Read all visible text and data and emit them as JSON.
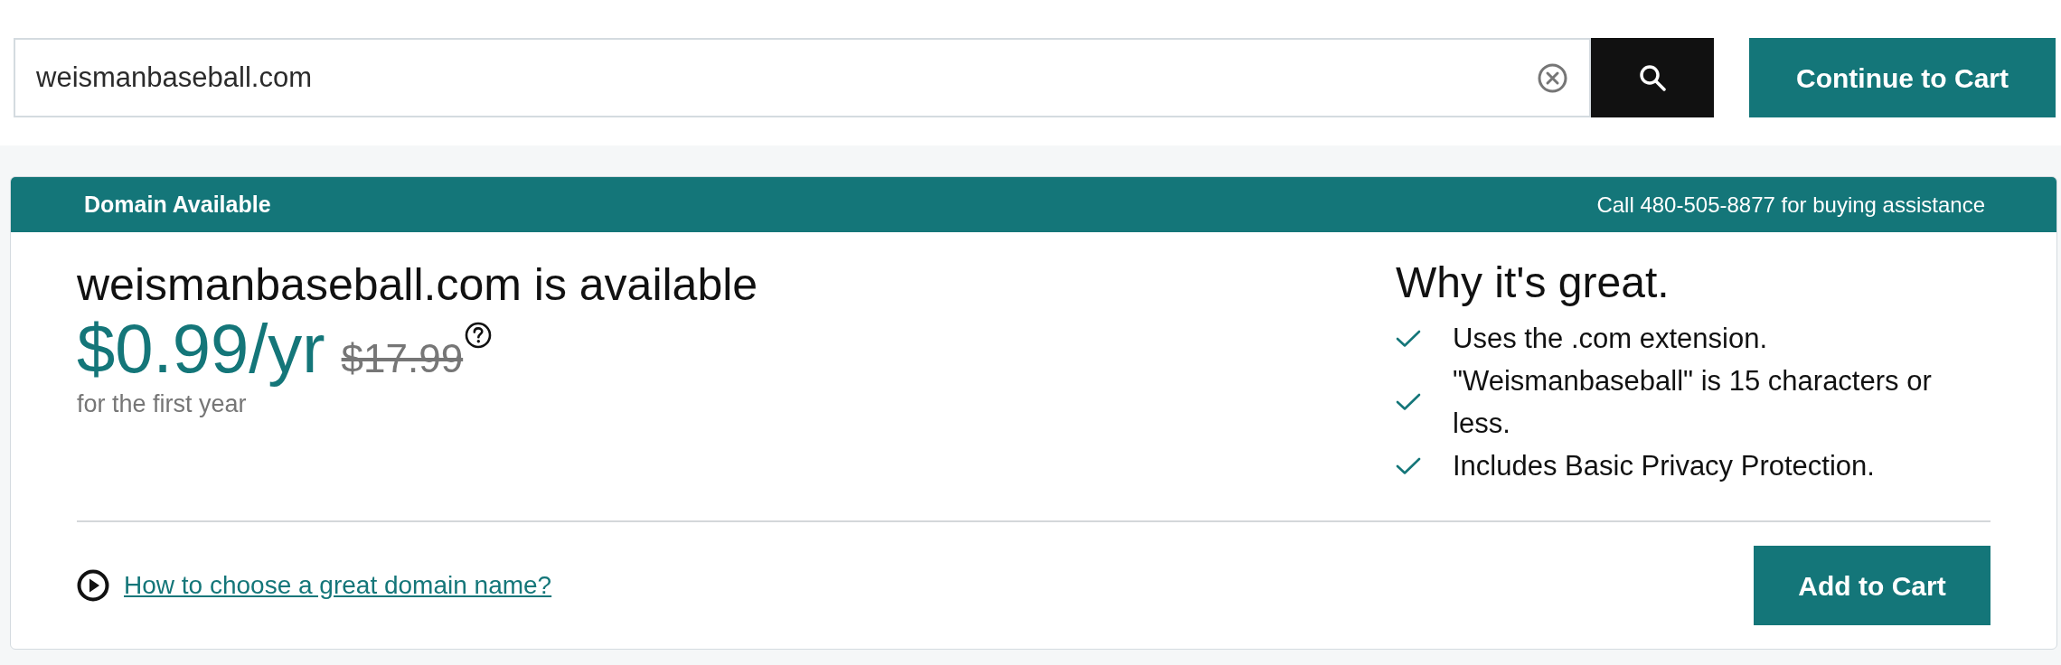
{
  "search": {
    "value": "weismanbaseball.com"
  },
  "continue_button": {
    "label": "Continue to Cart"
  },
  "result": {
    "header": {
      "title": "Domain Available",
      "phone_note": "Call 480-505-8877 for buying assistance"
    },
    "headline": "weismanbaseball.com is available",
    "price": "$0.99/yr",
    "original_price": "$17.99",
    "price_note": "for the first year",
    "why": {
      "title": "Why it's great.",
      "reasons": [
        "Uses the .com extension.",
        "\"Weismanbaseball\" is 15 characters or less.",
        "Includes Basic Privacy Protection."
      ]
    },
    "help_link": "How to choose a great domain name?",
    "add_button": {
      "label": "Add to Cart"
    }
  }
}
